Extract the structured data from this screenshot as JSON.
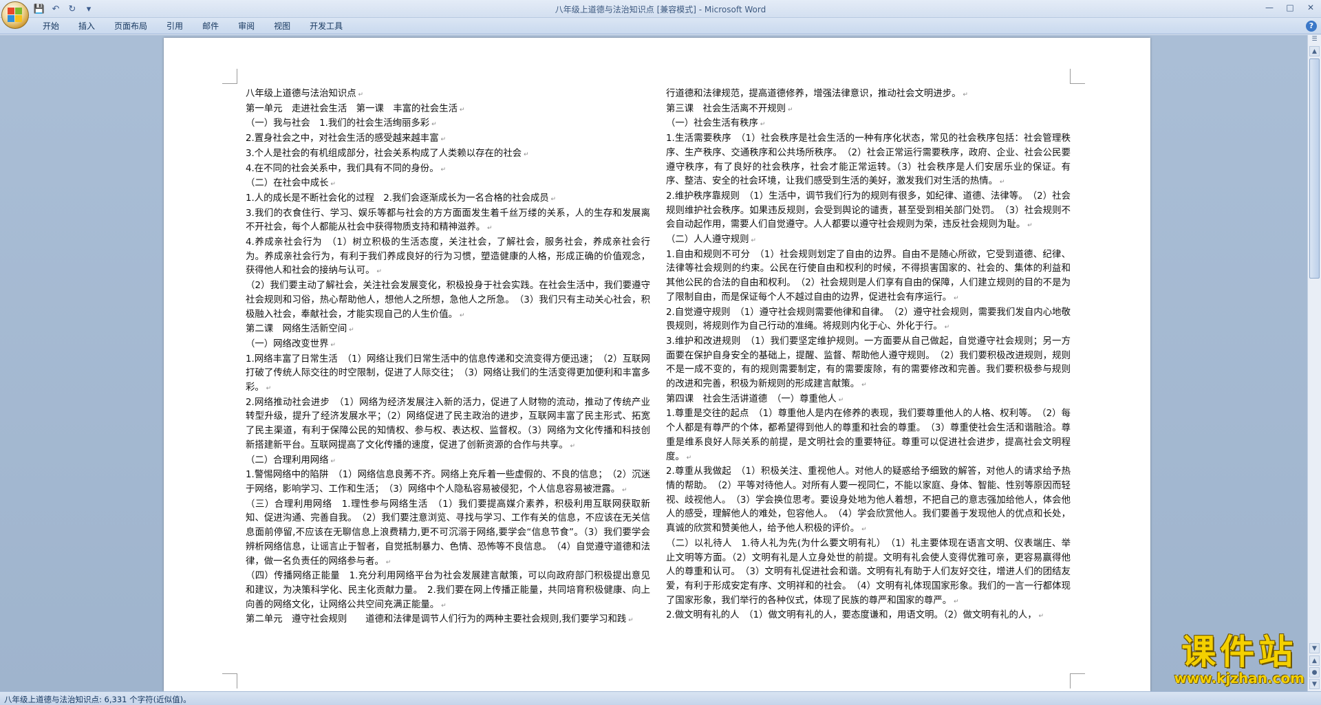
{
  "window": {
    "title": "八年级上道德与法治知识点 [兼容模式] - Microsoft Word"
  },
  "ribbon": {
    "tabs": [
      "开始",
      "插入",
      "页面布局",
      "引用",
      "邮件",
      "审阅",
      "视图",
      "开发工具"
    ]
  },
  "status": {
    "text": "八年级上道德与法治知识点: 6,331 个字符(近似值)。"
  },
  "watermark": {
    "title": "课件站",
    "url": "www.kjzhan.com"
  },
  "document": {
    "left_column": [
      "八年级上道德与法治知识点",
      "第一单元　走进社会生活　第一课　丰富的社会生活",
      "（一）我与社会　1.我们的社会生活绚丽多彩",
      "2.置身社会之中，对社会生活的感受越来越丰富",
      "3.个人是社会的有机组成部分，社会关系构成了人类赖以存在的社会",
      "4.在不同的社会关系中，我们具有不同的身份。",
      "（二）在社会中成长",
      "1.人的成长是不断社会化的过程　2.我们会逐渐成长为一名合格的社会成员",
      "3.我们的衣食住行、学习、娱乐等都与社会的方方面面发生着千丝万缕的关系，人的生存和发展离不开社会，每个人都能从社会中获得物质支持和精神滋养。",
      "4.养成亲社会行为　（1）树立积极的生活态度，关注社会，了解社会，服务社会，养成亲社会行为。养成亲社会行为，有利于我们养成良好的行为习惯，塑造健康的人格，形成正确的价值观念，获得他人和社会的接纳与认可。",
      "（2）我们要主动了解社会，关注社会发展变化，积极投身于社会实践。在社会生活中，我们要遵守社会规则和习俗，热心帮助他人，想他人之所想，急他人之所急。　（3）我们只有主动关心社会，积极融入社会，奉献社会，才能实现自己的人生价值。",
      "第二课　网络生活新空间",
      "（一）网络改变世界",
      "1.网络丰富了日常生活　（1）网络让我们日常生活中的信息传递和交流变得方便迅速；　（2）互联网打破了传统人际交往的时空限制，促进了人际交往；　（3）网络让我们的生活变得更加便利和丰富多彩。",
      "2.网络推动社会进步　（1）网络为经济发展注入新的活力，促进了人财物的流动，推动了传统产业转型升级，提升了经济发展水平；（2）网络促进了民主政治的进步，互联网丰富了民主形式、拓宽了民主渠道，有利于保障公民的知情权、参与权、表达权、监督权。（3）网络为文化传播和科技创新搭建新平台。互联网提高了文化传播的速度，促进了创新资源的合作与共享。",
      "（二）合理利用网络",
      "1.警惕网络中的陷阱　（1）网络信息良莠不齐。网络上充斥着一些虚假的、不良的信息；　（2）沉迷于网络，影响学习、工作和生活；　（3）网络中个人隐私容易被侵犯，个人信息容易被泄露。",
      "（三）合理利用网络　1.理性参与网络生活　（1）我们要提高媒介素养，积极利用互联网获取新知、促进沟通、完善自我。　（2）我们要注意浏览、寻找与学习、工作有关的信息，不应该在无关信息面前停留,不应该在无聊信息上浪费精力,更不可沉溺于网络,要学会“信息节食”。（3）我们要学会辨析网络信息，让谣言止于智者，自觉抵制暴力、色情、恐怖等不良信息。　（4）自觉遵守道德和法律，做一名负责任的网络参与者。",
      "（四）传播网络正能量　1.充分利用网络平台为社会发展建言献策，可以向政府部门积极提出意见和建议，为决策科学化、民主化贡献力量。　2.我们要在网上传播正能量，共同培育积极健康、向上向善的网络文化，让网络公共空间充满正能量。",
      "第二单元　遵守社会规则　　道德和法律是调节人们行为的两种主要社会规则,我们要学习和践"
    ],
    "right_column": [
      "行道德和法律规范，提高道德修养，增强法律意识，推动社会文明进步。",
      "第三课　社会生活离不开规则",
      "（一）社会生活有秩序",
      "1.生活需要秩序　（1）社会秩序是社会生活的一种有序化状态，常见的社会秩序包括：社会管理秩序、生产秩序、交通秩序和公共场所秩序。　（2）社会正常运行需要秩序，政府、企业、社会公民要遵守秩序，有了良好的社会秩序，社会才能正常运转。（3）社会秩序是人们安居乐业的保证。有序、整洁、安全的社会环境，让我们感受到生活的美好，激发我们对生活的热情。",
      "2.维护秩序靠规则　（1）生活中，调节我们行为的规则有很多，如纪律、道德、法律等。　（2）社会规则维护社会秩序。如果违反规则，会受到舆论的谴责，甚至受到相关部门处罚。　（3）社会规则不会自动起作用，需要人们自觉遵守。人人都要以遵守社会规则为荣，违反社会规则为耻。",
      "（二）人人遵守规则",
      "1.自由和规则不可分　（1）社会规则划定了自由的边界。自由不是随心所欲，它受到道德、纪律、法律等社会规则的约束。公民在行使自由和权利的时候，不得损害国家的、社会的、集体的利益和其他公民的合法的自由和权利。　（2）社会规则是人们享有自由的保障，人们建立规则的目的不是为了限制自由，而是保证每个人不越过自由的边界，促进社会有序运行。",
      "2.自觉遵守规则　（1）遵守社会规则需要他律和自律。　（2）遵守社会规则，需要我们发自内心地敬畏规则，将规则作为自己行动的准绳。将规则内化于心、外化于行。",
      "3.维护和改进规则　（1）我们要坚定维护规则。一方面要从自己做起，自觉遵守社会规则；另一方面要在保护自身安全的基础上，提醒、监督、帮助他人遵守规则。　（2）我们要积极改进规则，规则不是一成不变的，有的规则需要制定，有的需要废除，有的需要修改和完善。我们要积极参与规则的改进和完善，积极为新规则的形成建言献策。",
      "第四课　社会生活讲道德　（一）尊重他人",
      "1.尊重是交往的起点　（1）尊重他人是内在修养的表现，我们要尊重他人的人格、权利等。　（2）每个人都是有尊严的个体，都希望得到他人的尊重和社会的尊重。　（3）尊重使社会生活和谐融洽。尊重是维系良好人际关系的前提，是文明社会的重要特征。尊重可以促进社会进步，提高社会文明程度。",
      "2.尊重从我做起　（1）积极关注、重视他人。对他人的疑惑给予细致的解答，对他人的请求给予热情的帮助。　（2）平等对待他人。对所有人要一视同仁，不能以家庭、身体、智能、性别等原因而轻视、歧视他人。　（3）学会换位思考。要设身处地为他人着想，不把自己的意志强加给他人，体会他人的感受，理解他人的难处，包容他人。　（4）学会欣赏他人。我们要善于发现他人的优点和长处，真诚的欣赏和赞美他人，给予他人积极的评价。",
      "（二）以礼待人　1.待人礼为先(为什么要文明有礼）　（1）礼主要体现在语言文明、仪表端庄、举止文明等方面。（2）文明有礼是人立身处世的前提。文明有礼会使人变得优雅可亲，更容易赢得他人的尊重和认可。　（3）文明有礼促进社会和谐。文明有礼有助于人们友好交往，增进人们的团结友爱，有利于形成安定有序、文明祥和的社会。　（4）文明有礼体现国家形象。我们的一言一行都体现了国家形象，我们举行的各种仪式，体现了民族的尊严和国家的尊严。",
      "2.做文明有礼的人　（1）做文明有礼的人，要态度谦和，用语文明。（2）做文明有礼的人，"
    ]
  }
}
